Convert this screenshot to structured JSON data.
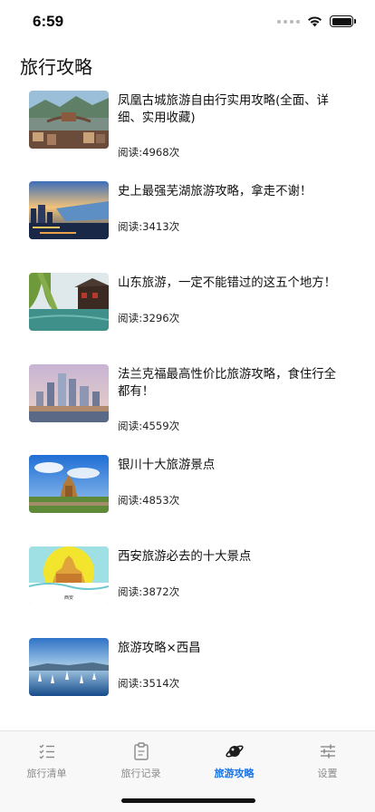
{
  "status": {
    "time": "6:59"
  },
  "page": {
    "title": "旅行攻略"
  },
  "articles": [
    {
      "title": "凤凰古城旅游自由行实用攻略(全面、详细、实用收藏)",
      "reads": "阅读:4968次",
      "image": "fenghuang-ancient-town-photo"
    },
    {
      "title": "史上最强芜湖旅游攻略，拿走不谢！",
      "reads": "阅读:3413次",
      "image": "wuhu-city-sunset-photo"
    },
    {
      "title": "山东旅游，一定不能错过的这五个地方！",
      "reads": "阅读:3296次",
      "image": "shandong-willow-lake-photo"
    },
    {
      "title": "法兰克福最高性价比旅游攻略，食住行全都有！",
      "reads": "阅读:4559次",
      "image": "frankfurt-skyline-photo"
    },
    {
      "title": "银川十大旅游景点",
      "reads": "阅读:4853次",
      "image": "yinchuan-temple-photo"
    },
    {
      "title": "西安旅游必去的十大景点",
      "reads": "阅读:3872次",
      "image": "xian-illustration",
      "image_text": "西安"
    },
    {
      "title": "旅游攻略×西昌",
      "reads": "阅读:3514次",
      "image": "xichang-lake-boats-photo"
    }
  ],
  "tabs": [
    {
      "label": "旅行清单",
      "icon": "checklist-icon",
      "active": false
    },
    {
      "label": "旅行记录",
      "icon": "clipboard-icon",
      "active": false
    },
    {
      "label": "旅游攻略",
      "icon": "planet-icon",
      "active": true
    },
    {
      "label": "设置",
      "icon": "sliders-icon",
      "active": false
    }
  ],
  "colors": {
    "accent": "#1a73e8",
    "tab_inactive": "#8a8a8a"
  }
}
